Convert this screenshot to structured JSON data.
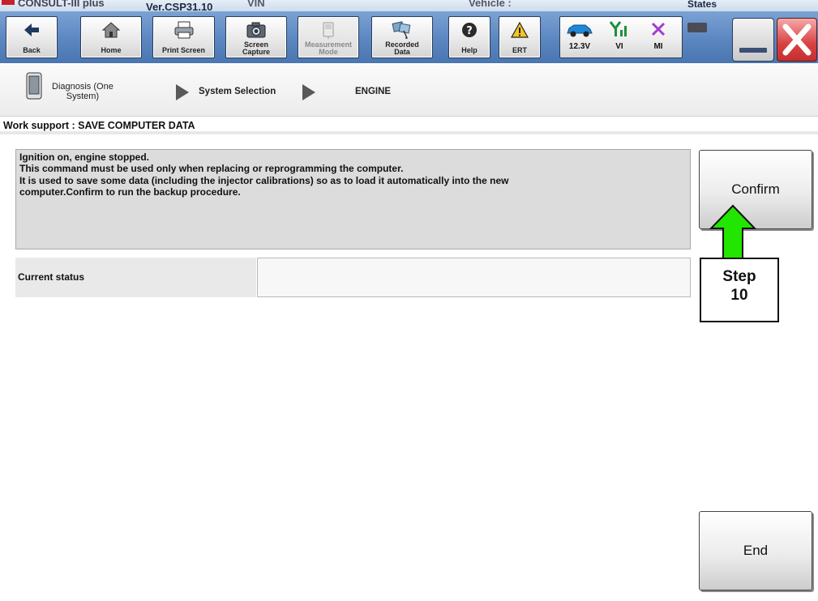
{
  "titlebar": {
    "app_name": "CONSULT-III plus",
    "version": "Ver.CSP31.10",
    "vin_label": "VIN",
    "vehicle_label": "Vehicle :",
    "states_label": "States"
  },
  "toolbar": {
    "back_label": "Back",
    "home_label": "Home",
    "print_label": "Print Screen",
    "screen_capture_line1": "Screen",
    "screen_capture_line2": "Capture",
    "measurement_line1": "Measurement",
    "measurement_line2": "Mode",
    "recorded_line1": "Recorded",
    "recorded_line2": "Data",
    "help_label": "Help",
    "ert_label": "ERT"
  },
  "status_indicators": {
    "voltage": "12.3V",
    "vi_label": "VI",
    "mi_label": "MI"
  },
  "breadcrumb": {
    "item1_line1": "Diagnosis (One",
    "item1_line2": "System)",
    "item2": "System Selection",
    "item3": "ENGINE"
  },
  "page": {
    "title": "Work support : SAVE COMPUTER DATA"
  },
  "message": {
    "lines": [
      "Ignition on, engine stopped.",
      "This command must be used only when replacing or reprogramming the computer.",
      "It is used to save some data (including the injector calibrations) so as to load it automatically into the new",
      "computer.Confirm to run the backup procedure."
    ]
  },
  "status": {
    "label": "Current status",
    "value": ""
  },
  "buttons": {
    "confirm": "Confirm",
    "end": "End"
  },
  "annotation": {
    "step_line1": "Step",
    "step_line2": "10",
    "arrow_color": "#22e600"
  },
  "colors": {
    "toolbar_blue": "#5b86c0",
    "close_red": "#d84141",
    "vi_green": "#1f8f3a",
    "mi_purple": "#a23bd1",
    "car_blue": "#1e88d8"
  }
}
